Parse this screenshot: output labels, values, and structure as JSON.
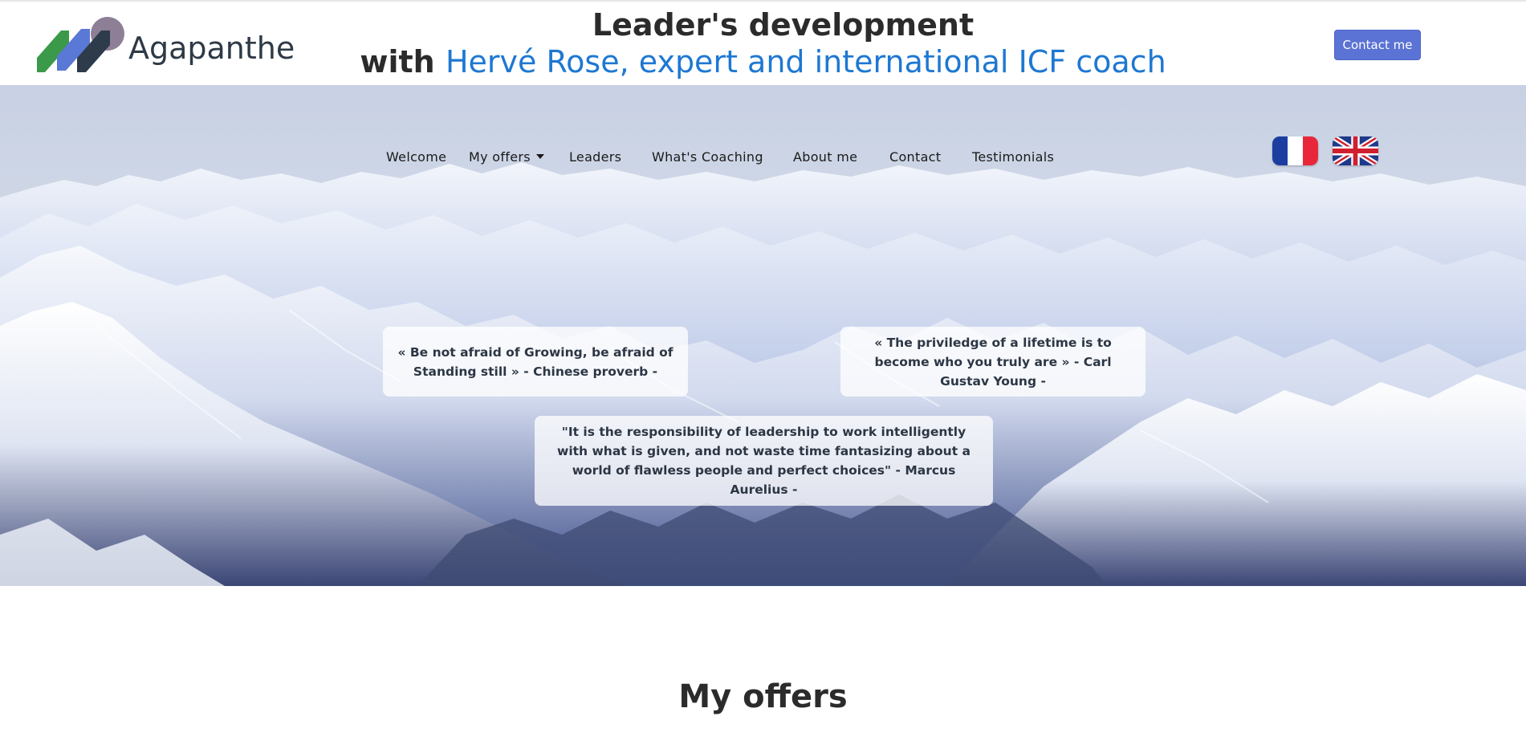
{
  "header": {
    "logo_text": "Agapanthe",
    "headline_line1": "Leader's development",
    "headline_prefix": "with",
    "headline_accent": "Hervé Rose, expert and international ICF coach",
    "contact_button": "Contact me",
    "accent_color": "#1e78d2",
    "button_color": "#5b73d4"
  },
  "nav": {
    "items": [
      {
        "label": "Welcome"
      },
      {
        "label": "My offers",
        "dropdown": true
      },
      {
        "label": "Leaders"
      },
      {
        "label": "What's Coaching"
      },
      {
        "label": "About me"
      },
      {
        "label": "Contact"
      },
      {
        "label": "Testimonials"
      }
    ]
  },
  "languages": [
    {
      "icon": "french-flag-icon"
    },
    {
      "icon": "uk-flag-icon"
    }
  ],
  "hero": {
    "background": "snowy-alps-panorama",
    "quotes": [
      "« Be not afraid of Growing, be afraid of Standing still » - Chinese proverb -",
      "« The priviledge of a lifetime is to become who you truly are » - Carl Gustav Young -",
      "\"It is the responsibility of leadership to work intelligently with what is given, and not waste time fantasizing about a world of flawless people and perfect choices\" - Marcus Aurelius -"
    ]
  },
  "section": {
    "title": "My offers"
  }
}
